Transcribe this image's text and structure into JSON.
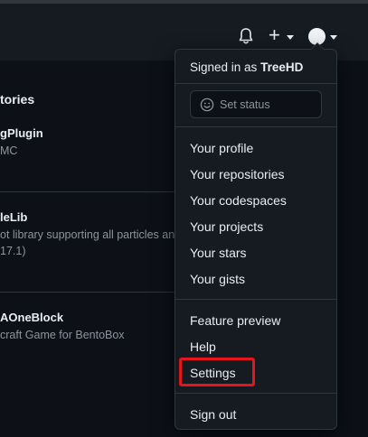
{
  "header": {
    "icons": [
      "bell-icon",
      "plus-icon",
      "chevron-down-icon",
      "avatar"
    ]
  },
  "repos": {
    "title": "tories",
    "items": [
      {
        "name": "gPlugin",
        "desc": "MC"
      },
      {
        "name": "leLib",
        "desc": "ot library supporting all particles and",
        "desc2": "17.1)"
      },
      {
        "name": "AOneBlock",
        "desc": "craft Game for BentoBox"
      }
    ]
  },
  "menu": {
    "signed_prefix": "Signed in as",
    "username": "TreeHD",
    "status_placeholder": "Set status",
    "group1": [
      "Your profile",
      "Your repositories",
      "Your codespaces",
      "Your projects",
      "Your stars",
      "Your gists"
    ],
    "group2": [
      "Feature preview",
      "Help",
      "Settings"
    ],
    "signout": "Sign out"
  },
  "colors": {
    "background": "#0d1117",
    "menu_bg": "#161b22",
    "border": "#30363d",
    "highlight": "#e4161b"
  }
}
